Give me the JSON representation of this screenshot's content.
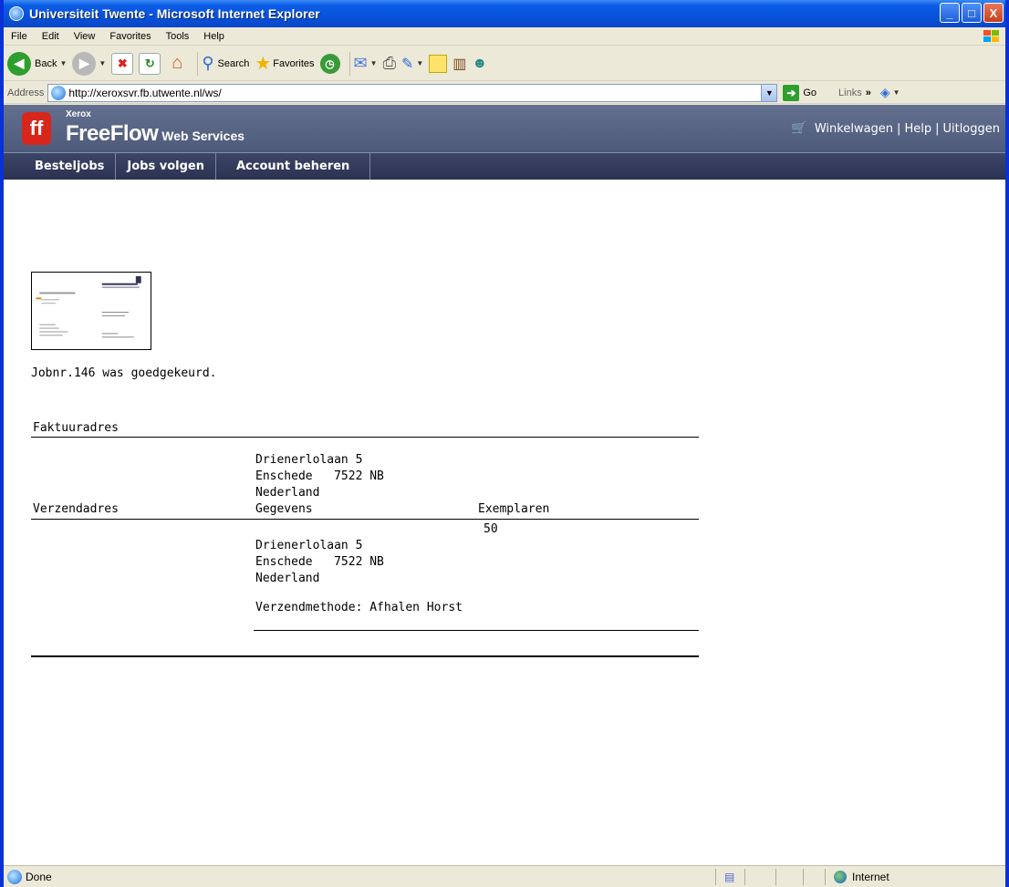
{
  "window": {
    "title": "Universiteit Twente - Microsoft Internet Explorer",
    "min": "_",
    "max": "□",
    "close": "X"
  },
  "menu": [
    "File",
    "Edit",
    "View",
    "Favorites",
    "Tools",
    "Help"
  ],
  "toolbar": {
    "back": "Back",
    "search": "Search",
    "favorites": "Favorites"
  },
  "address": {
    "label": "Address",
    "url": "http://xeroxsvr.fb.utwente.nl/ws/",
    "go": "Go",
    "links": "Links"
  },
  "header": {
    "brand": "Xerox",
    "product": "FreeFlow",
    "product_sub": " Web Services",
    "links": [
      "Winkelwagen",
      "Help",
      "Uitloggen"
    ],
    "separator": "|"
  },
  "nav": [
    "Besteljobs",
    "Jobs volgen",
    "Account beheren"
  ],
  "job": {
    "status": "Jobnr.146 was goedgekeurd."
  },
  "billing": {
    "heading": "Faktuuradres",
    "address_line1": "Drienerlolaan 5",
    "address_city": "Enschede   7522 NB",
    "address_country": "Nederland"
  },
  "shipping": {
    "heading": "Verzendadres",
    "col_gegevens": "Gegevens",
    "col_exemplaren": "Exemplaren",
    "copies": "50",
    "address_line1": "Drienerlolaan 5",
    "address_city": "Enschede   7522 NB",
    "address_country": "Nederland",
    "method": "Verzendmethode: Afhalen Horst"
  },
  "status": {
    "text": "Done",
    "zone": "Internet"
  }
}
